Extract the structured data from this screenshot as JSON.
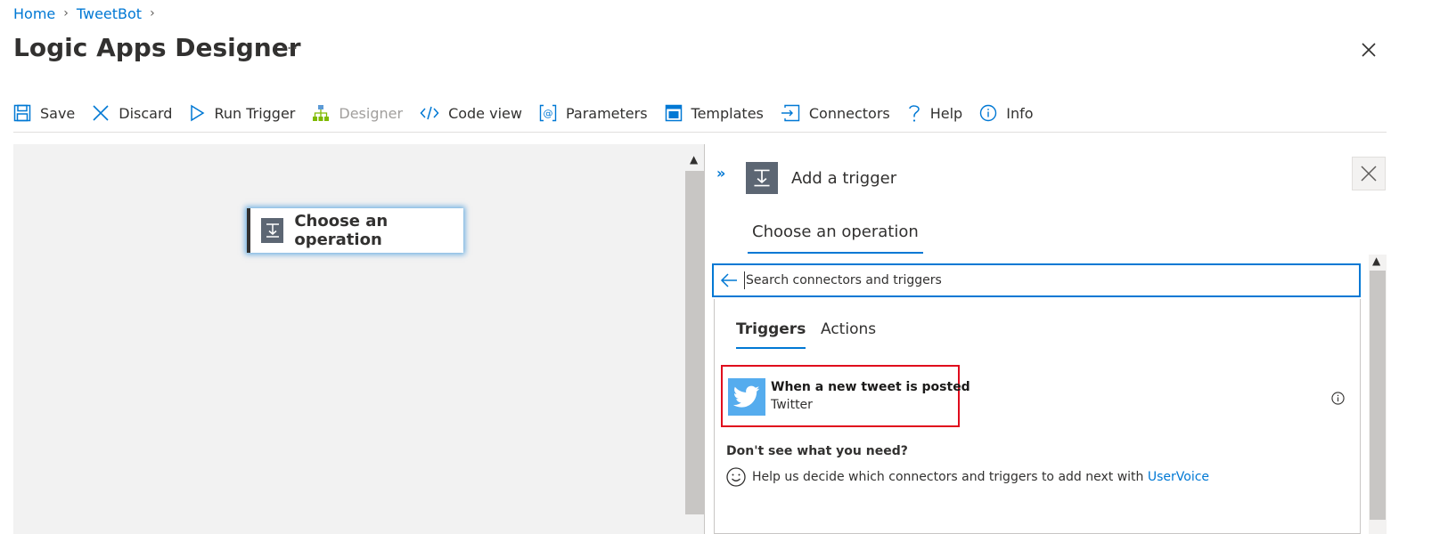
{
  "breadcrumb": {
    "home": "Home",
    "app": "TweetBot"
  },
  "page": {
    "title": "Logic Apps Designer",
    "more": "···"
  },
  "toolbar": {
    "save": "Save",
    "discard": "Discard",
    "run_trigger": "Run Trigger",
    "designer": "Designer",
    "code_view": "Code view",
    "parameters": "Parameters",
    "templates": "Templates",
    "connectors": "Connectors",
    "help": "Help",
    "info": "Info"
  },
  "canvas": {
    "card_label": "Choose an operation"
  },
  "panel": {
    "title": "Add a trigger",
    "tab": "Choose an operation",
    "search_placeholder": "Search connectors and triggers",
    "tabs": {
      "triggers": "Triggers",
      "actions": "Actions"
    },
    "result": {
      "title": "When a new tweet is posted",
      "connector": "Twitter"
    },
    "help_title": "Don't see what you need?",
    "help_text": "Help us decide which connectors and triggers to add next with ",
    "help_link": "UserVoice"
  },
  "colors": {
    "accent": "#0078d4",
    "highlight": "#e00b1c",
    "twitter": "#55acee"
  }
}
